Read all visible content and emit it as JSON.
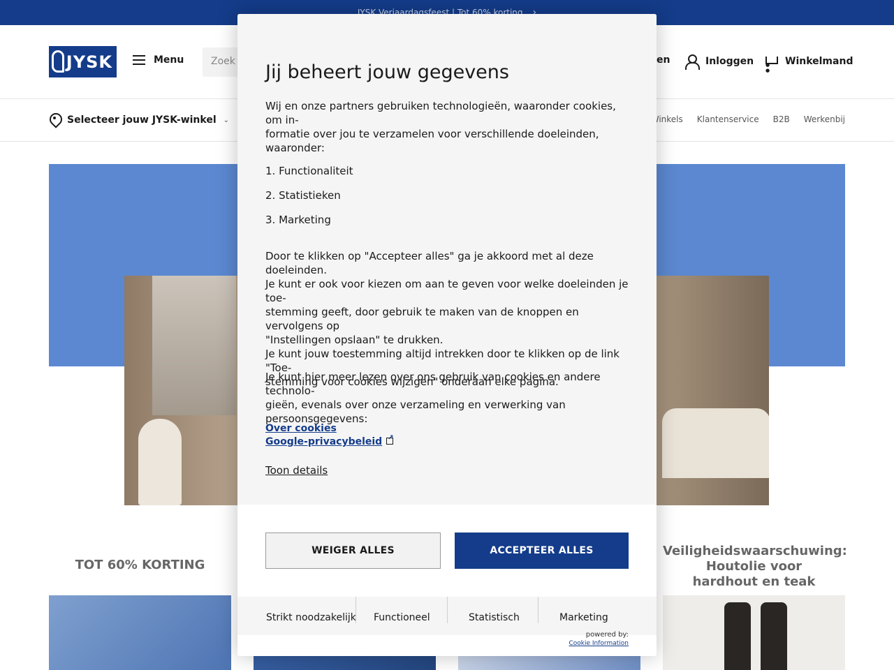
{
  "promo_bar": {
    "text": "JYSK Verjaardagsfeest | Tot 60% korting"
  },
  "header": {
    "logo_text": "JYSK",
    "menu_label": "Menu",
    "search_placeholder": "Zoek p",
    "hidden_link_fragment": "en",
    "login_label": "Inloggen",
    "cart_label": "Winkelmand"
  },
  "subnav": {
    "store_label": "Selecteer jouw JYSK-winkel",
    "links": [
      "Winkels",
      "Klantenservice",
      "B2B",
      "Werkenbij"
    ]
  },
  "cards": {
    "discount_title": "TOT 60% KORTING",
    "safety_title_l1": "Veiligheidswaarschuwing:",
    "safety_title_l2": "Houtolie voor",
    "safety_title_l3": "hardhout en teak"
  },
  "modal": {
    "title": "Jij beheert jouw gegevens",
    "intro_l1": "Wij en onze partners gebruiken technologieën, waaronder cookies, om in-",
    "intro_l2": "formatie over jou te verzamelen voor verschillende doeleinden, waaronder:",
    "purposes": [
      "1. Functionaliteit",
      "2. Statistieken",
      "3. Marketing"
    ],
    "consent_l1": "Door te klikken op \"Accepteer alles\" ga je akkoord met al deze doeleinden.",
    "consent_l2": "Je kunt er ook voor kiezen om aan te geven voor welke doeleinden je toe-",
    "consent_l3": "stemming geeft, door gebruik te maken van de knoppen en vervolgens op",
    "consent_l4": "\"Instellingen opslaan\" te drukken.",
    "consent_l5": "Je kunt jouw toestemming altijd intrekken door te klikken op de link \"Toe-",
    "consent_l6": "stemming voor cookies wijzigen\" onderaan elke pagina.",
    "more_l1": "Je kunt hier meer lezen over ons gebruik van cookies en andere technolo-",
    "more_l2": "gieën, evenals over onze verzameling en verwerking van",
    "more_l3": "persoonsgegevens:",
    "link_cookies": "Over cookies",
    "link_privacy": "Google-privacybeleid",
    "details_label": "Toon details",
    "deny_label": "WEIGER ALLES",
    "accept_label": "ACCEPTEER ALLES",
    "tabs": [
      "Strikt noodzakelijk",
      "Functioneel",
      "Statistisch",
      "Marketing"
    ],
    "powered_by": "powered by:",
    "provider": "Cookie Information"
  },
  "colors": {
    "brand": "#143c8a",
    "hero_blue": "#5b88d0"
  }
}
